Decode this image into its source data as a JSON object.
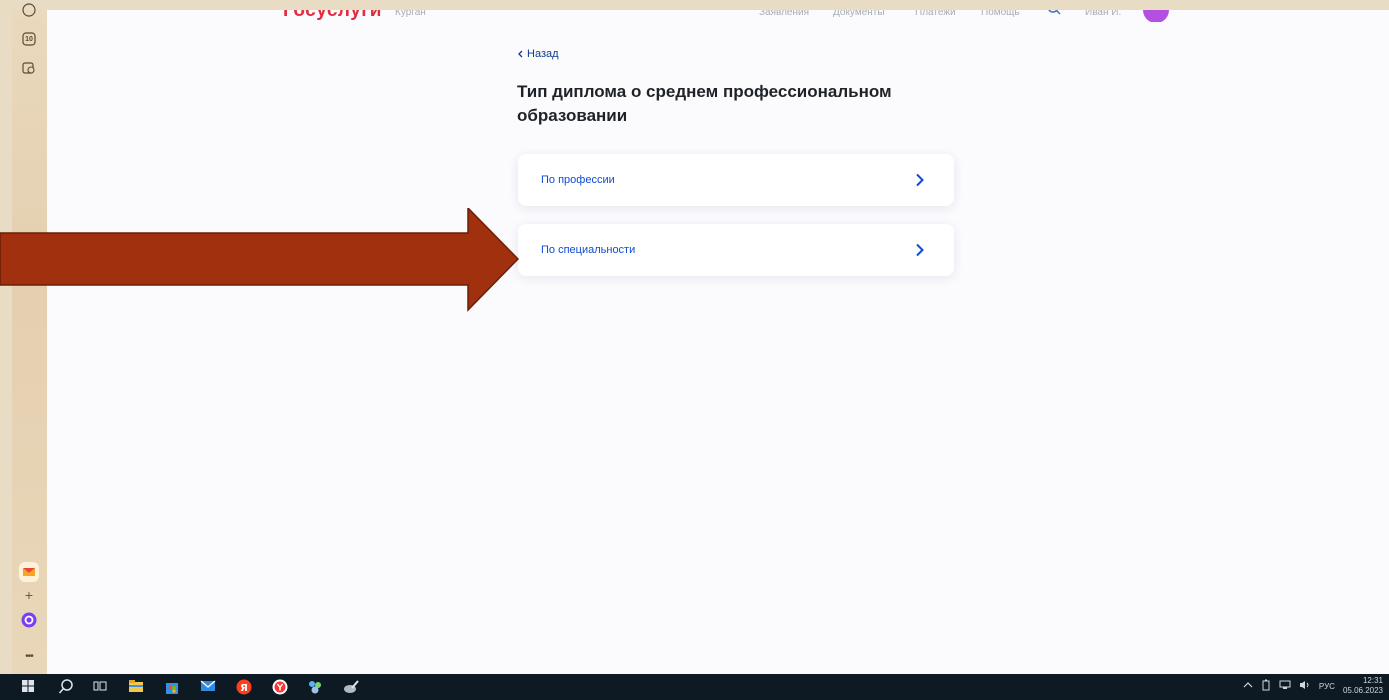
{
  "header": {
    "logo_text": "Госуслуги",
    "region": "Курган",
    "links": [
      "Заявления",
      "Документы",
      "Платежи",
      "Помощь"
    ],
    "user_short": "Иван И."
  },
  "back_link": "Назад",
  "page_title": "Тип диплома о среднем профессиональном образовании",
  "options": [
    {
      "label": "По профессии"
    },
    {
      "label": "По специальности"
    }
  ],
  "sidebar": {
    "badge_count": "10"
  },
  "taskbar": {
    "language": "РУС",
    "time": "12:31",
    "date": "05.06.2023"
  },
  "colors": {
    "arrow_fill": "#a0300e",
    "link_blue": "#0d4cd3",
    "logo_red": "#e12d3e",
    "avatar_purple": "#b44fe0"
  }
}
